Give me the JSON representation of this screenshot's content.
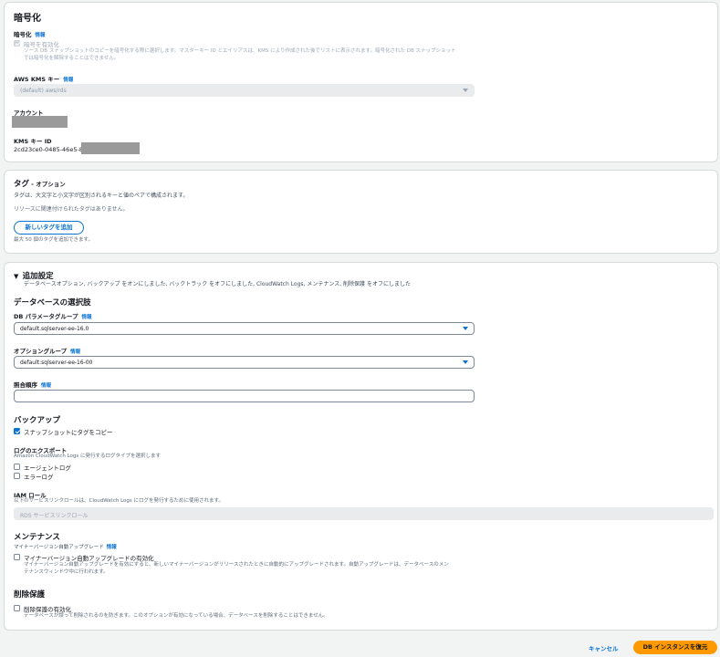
{
  "encryption": {
    "title": "暗号化",
    "section_label": "暗号化",
    "info": "情報",
    "checkbox_label": "暗号を有効化",
    "checkbox_desc_1": "ソース DB スナップショットのコピーを暗号化する際に選択します。マスターキー ID とエイリアスは、KMS により作成された後でリストに表示されます。暗号化された DB スナップショット",
    "checkbox_desc_2": "では暗号化を解除することはできません。",
    "kms_label": "AWS KMS キー",
    "kms_info": "情報",
    "kms_value": "(default) aws/rds",
    "account_label": "アカウント",
    "kms_id_label": "KMS キー ID",
    "kms_id_value": "2cd23ce0-0485-46e5-87"
  },
  "tags": {
    "title": "タグ",
    "title_suffix": " - オプション",
    "desc": "タグは、大文字と小文字が区別されるキーと値のペアで構成されます。",
    "empty": "リソースに関連付けられたタグはありません。",
    "add_button": "新しいタグを追加",
    "limit": "最大 50 個のタグを追加できます。"
  },
  "additional": {
    "title": "追加設定",
    "summary": "データベースオプション, バックアップ をオンにしました, バックトラック をオフにしました, CloudWatch Logs, メンテナンス, 削除保護 をオフにしました",
    "db_options_title": "データベースの選択肢",
    "param_group_label": "DB パラメータグループ",
    "param_group_info": "情報",
    "param_group_value": "default.sqlserver-ee-16.0",
    "option_group_label": "オプショングループ",
    "option_group_info": "情報",
    "option_group_value": "default:sqlserver-ee-16-00",
    "collation_label": "照合順序",
    "collation_info": "情報",
    "backup_title": "バックアップ",
    "copy_tags_label": "スナップショットにタグをコピー",
    "log_export_label": "ログのエクスポート",
    "log_export_desc": "Amazon CloudWatch Logs に発行するログタイプを選択します",
    "agent_log": "エージェントログ",
    "error_log": "エラーログ",
    "iam_role_label": "IAM ロール",
    "iam_role_desc": "以下のサービスリンクロールは、CloudWatch Logs にログを発行するために使用されます。",
    "iam_role_value": "RDS サービスリンクロール",
    "maintenance_title": "メンテナンス",
    "minor_upgrade_header": "マイナーバージョン自動アップグレード",
    "minor_upgrade_info": "情報",
    "minor_upgrade_checkbox": "マイナーバージョン自動アップグレードの有効化",
    "minor_upgrade_desc_1": "マイナーバージョン自動アップグレードを有効にすると、新しいマイナーバージョンがリリースされたときに自動的にアップグレードされます。自動アップグレードは、データベースのメン",
    "minor_upgrade_desc_2": "テナンスウィンドウ中に行われます。",
    "deletion_title": "削除保護",
    "deletion_checkbox": "削除保護の有効化",
    "deletion_desc": "データベースが誤って削除されるのを防ぎます。このオプションが有効になっている場合、データベースを削除することはできません。"
  },
  "footer": {
    "cancel": "キャンセル",
    "restore": "DB インスタンスを復元"
  },
  "colors": {
    "accent": "#0972d3",
    "primary_button": "#ff9900"
  }
}
